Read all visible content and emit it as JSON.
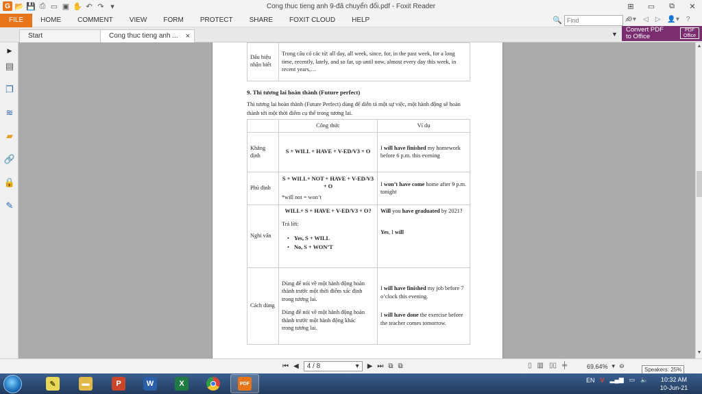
{
  "window": {
    "title": "Cong thuc tieng anh 9-đã chuyển đổi.pdf - Foxit Reader",
    "app_logo": "G"
  },
  "menu": {
    "items": [
      "FILE",
      "HOME",
      "COMMENT",
      "VIEW",
      "FORM",
      "PROTECT",
      "SHARE",
      "FOXIT CLOUD",
      "HELP"
    ],
    "search_placeholder": "Find"
  },
  "tabs": {
    "start": "Start",
    "active": "Cong thuc tieng anh ...",
    "close": "×"
  },
  "convert": {
    "line1": "Convert PDF",
    "line2": "to Office",
    "badge_top": "PDF",
    "badge_bottom": "Office"
  },
  "doc": {
    "top_table": {
      "label": "Dấu hiệu nhận biết",
      "text": "Trong câu có các từ: all day, all week, since, for, in the past week, for a long time, recently, lately, and so far, up until now, almost every day this week, in recent years,…"
    },
    "heading": "9. Thì tương lai hoàn thành (Future perfect)",
    "intro": "Thì tương lai hoàn thành (Future Perfect) dùng để diễn tả một sự việc, một hành động sẽ hoàn thành tới một thời điểm cụ thể trong tương lai.",
    "col_formula": "Công thức",
    "col_example": "Ví dụ",
    "affirm": {
      "label": "Khẳng định",
      "formula": "S + WILL + HAVE + V-ED/V3 + O",
      "ex_1": "I ",
      "ex_bold": "will have finished",
      "ex_2": " my homework before 6 p.m. this evening"
    },
    "negative": {
      "label": "Phủ định",
      "formula": "S + WILL+ NOT + HAVE + V-ED/V3 + O",
      "note": "*will not = won’t",
      "ex_1": "I ",
      "ex_bold": "won’t have come",
      "ex_2": " home after 9 p.m. tonight"
    },
    "question": {
      "label": "Nghi vấn",
      "formula": "WILL+ S + HAVE + V-ED/V3 + O?",
      "answer_label": "Trả lời:",
      "yes_bold": "Yes",
      "yes_rest": ", S + WILL",
      "no_bold": "No",
      "no_rest": ", S + WON’T",
      "ex_bold1": "Will",
      "ex_mid": " you ",
      "ex_bold2": "have graduated",
      "ex_end": " by 2021?",
      "ans_bold1": "Yes",
      "ans_mid": ", I ",
      "ans_bold2": "will"
    },
    "usage": {
      "label": "Cách dùng",
      "use1": "Dùng để nói về một hành động hoàn thành trước một thời điểm xác định",
      "use1_tail": "trong tương lai.",
      "use2": "Dùng để nói về một hành động hoàn thành trước một hành động khác",
      "use2_tail": "trong tương lai.",
      "ex1_1": "I ",
      "ex1_bold": "will have finished",
      "ex1_2": " my job before 7 o’clock this evening.",
      "ex2_1": "I ",
      "ex2_bold": "will have done",
      "ex2_2": " the exercise before the teacher comes tomorrow."
    }
  },
  "status": {
    "page_value": "4 / 8",
    "zoom": "69.64%",
    "tooltip": "Speakers: 25%"
  },
  "tray": {
    "lang": "EN",
    "time": "10:32 AM",
    "date": "10-Jun-21"
  },
  "taskbar": {
    "powerpoint": "P",
    "word": "W",
    "excel": "X",
    "foxit": "PDF"
  }
}
